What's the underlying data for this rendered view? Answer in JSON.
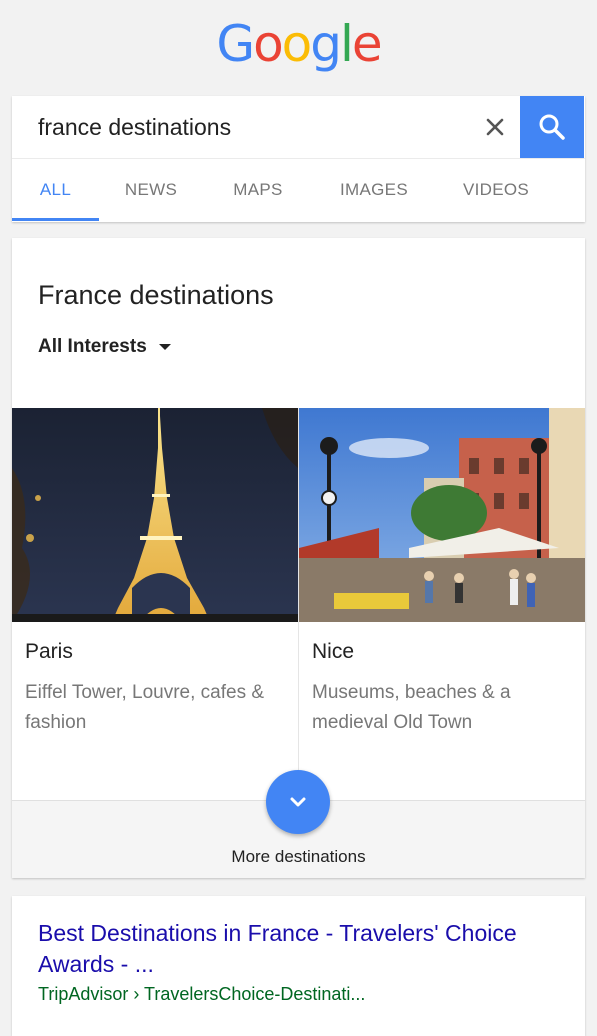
{
  "logo": {
    "letters": [
      "G",
      "o",
      "o",
      "g",
      "l",
      "e"
    ],
    "colors": [
      "#4285f4",
      "#ea4335",
      "#fbbc05",
      "#4285f4",
      "#34a853",
      "#ea4335"
    ]
  },
  "search": {
    "query": "france destinations",
    "clear_icon": "close-icon",
    "search_icon": "search-icon"
  },
  "tabs": [
    {
      "label": "ALL",
      "active": true
    },
    {
      "label": "NEWS"
    },
    {
      "label": "MAPS"
    },
    {
      "label": "IMAGES"
    },
    {
      "label": "VIDEOS"
    }
  ],
  "card": {
    "title": "France destinations",
    "filter": "All Interests",
    "destinations": [
      {
        "name": "Paris",
        "description": "Eiffel Tower, Louvre, cafes & fashion"
      },
      {
        "name": "Nice",
        "description": "Museums, beaches & a medieval Old Town"
      }
    ],
    "more_label": "More destinations"
  },
  "result": {
    "title": "Best Destinations in France - Travelers' Choice Awards - ...",
    "url": "TripAdvisor › TravelersChoice-Destinati..."
  },
  "colors": {
    "accent": "#4285f4",
    "link": "#1a0dab",
    "url": "#006621"
  }
}
